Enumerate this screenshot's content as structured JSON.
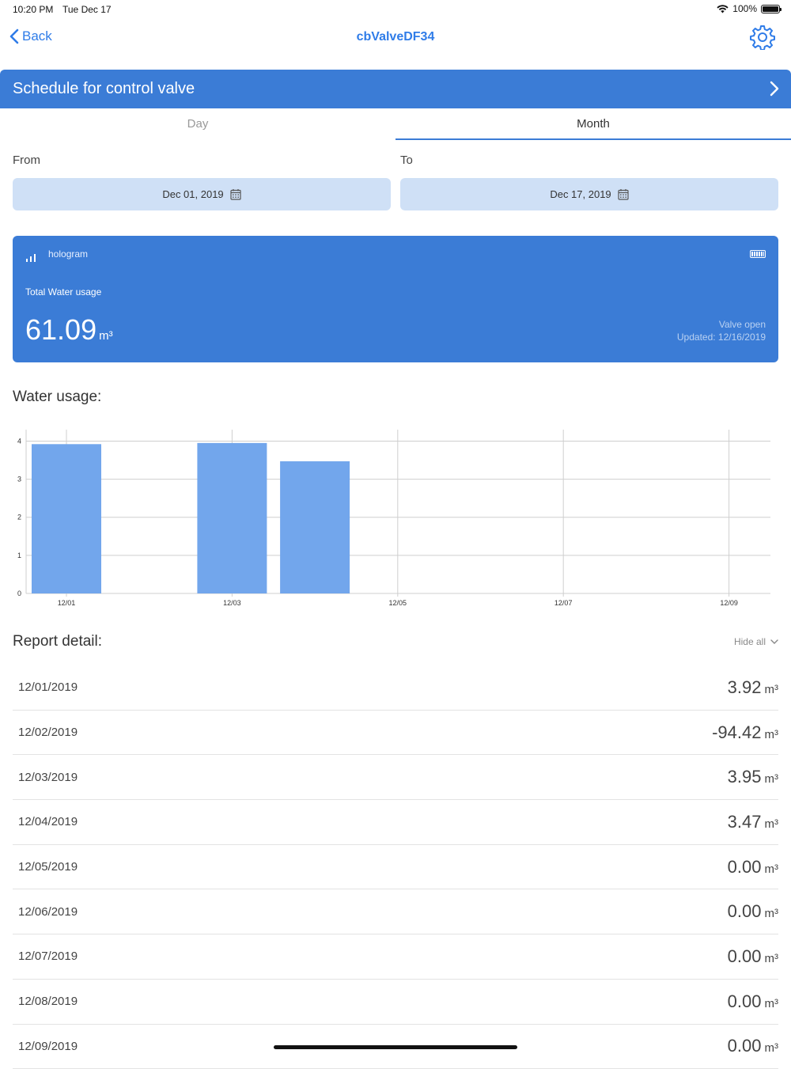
{
  "status_bar": {
    "time": "10:20 PM",
    "date": "Tue Dec 17",
    "battery": "100%",
    "icons": [
      "wifi-icon",
      "battery-icon"
    ]
  },
  "nav": {
    "back_label": "Back",
    "title": "cbValveDF34",
    "settings_icon": "gear-icon"
  },
  "schedule": {
    "label": "Schedule for control valve"
  },
  "tabs": [
    {
      "label": "Day",
      "active": false
    },
    {
      "label": "Month",
      "active": true
    }
  ],
  "range": {
    "from_label": "From",
    "from_value": "Dec 01, 2019",
    "to_label": "To",
    "to_value": "Dec 17, 2019"
  },
  "summary": {
    "carrier": "hologram",
    "usage_label": "Total Water usage",
    "usage_value": "61.09",
    "usage_unit": "m³",
    "valve_status": "Valve open",
    "updated": "Updated: 12/16/2019"
  },
  "chart_section": {
    "title": "Water usage:"
  },
  "chart_data": {
    "type": "bar",
    "categories": [
      "12/01",
      "12/02",
      "12/03",
      "12/04",
      "12/05",
      "12/06",
      "12/07",
      "12/08",
      "12/09"
    ],
    "values": [
      3.92,
      0,
      3.95,
      3.47,
      0,
      0,
      0,
      0,
      0
    ],
    "x_tick_labels": [
      "12/01",
      "12/03",
      "12/05",
      "12/07",
      "12/09"
    ],
    "y_ticks": [
      "0",
      "1",
      "2",
      "3",
      "4"
    ],
    "ylim": [
      0,
      4.3
    ],
    "grid": true,
    "bar_color": "#72a6ec"
  },
  "report": {
    "title": "Report detail:",
    "hide_all_label": "Hide all",
    "unit": "m³",
    "rows": [
      {
        "date": "12/01/2019",
        "value": "3.92"
      },
      {
        "date": "12/02/2019",
        "value": "-94.42"
      },
      {
        "date": "12/03/2019",
        "value": "3.95"
      },
      {
        "date": "12/04/2019",
        "value": "3.47"
      },
      {
        "date": "12/05/2019",
        "value": "0.00"
      },
      {
        "date": "12/06/2019",
        "value": "0.00"
      },
      {
        "date": "12/07/2019",
        "value": "0.00"
      },
      {
        "date": "12/08/2019",
        "value": "0.00"
      },
      {
        "date": "12/09/2019",
        "value": "0.00"
      }
    ]
  },
  "colors": {
    "accent": "#3b7cd6",
    "link": "#2f7ce8",
    "date_box": "#cfe0f6"
  }
}
